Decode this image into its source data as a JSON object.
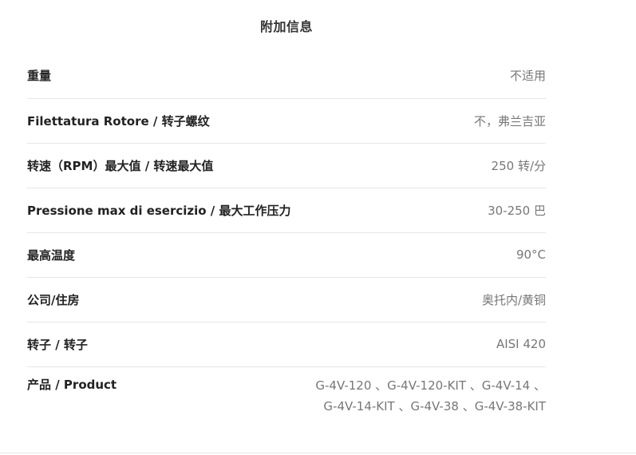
{
  "section": {
    "title": "附加信息"
  },
  "specs": [
    {
      "label": "重量",
      "value": "不适用"
    },
    {
      "label": "Filettatura Rotore / 转子螺纹",
      "value": "不，弗兰吉亚"
    },
    {
      "label": "转速（RPM）最大值 / 转速最大值",
      "value": "250 转/分"
    },
    {
      "label": "Pressione max di esercizio / 最大工作压力",
      "value": "30-250 巴"
    },
    {
      "label": "最高温度",
      "value": "90°C"
    },
    {
      "label": "公司/住房",
      "value": "奥托内/黄铜"
    },
    {
      "label": "转子 / 转子",
      "value": "AISI 420"
    },
    {
      "label": "产品 / Product",
      "value": "G-4V-120 、G-4V-120-KIT 、G-4V-14 、G-4V-14-KIT 、G-4V-38 、G-4V-38-KIT"
    }
  ]
}
